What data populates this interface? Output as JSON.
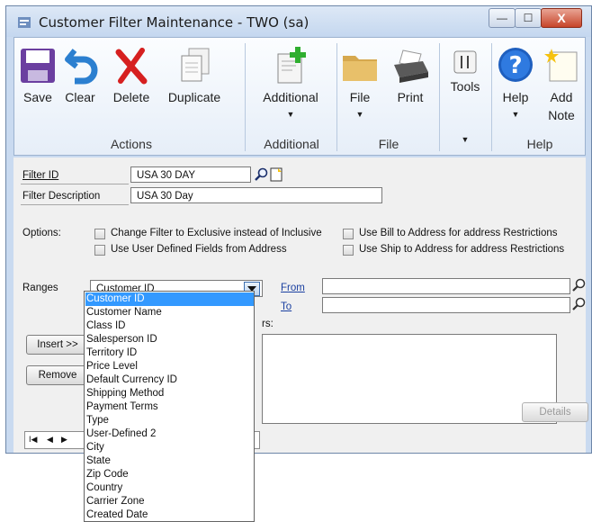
{
  "window": {
    "title": "Customer Filter Maintenance  -  TWO (sa)",
    "caption_min": "—",
    "caption_max": "☐",
    "caption_close": "X"
  },
  "ribbon": {
    "save": "Save",
    "clear": "Clear",
    "delete": "Delete",
    "duplicate": "Duplicate",
    "additional": "Additional",
    "file": "File",
    "print": "Print",
    "tools": "Tools",
    "help": "Help",
    "add_note_1": "Add",
    "add_note_2": "Note",
    "groups": {
      "actions": "Actions",
      "additional": "Additional",
      "file": "File",
      "help": "Help"
    }
  },
  "form": {
    "filter_id_label": "Filter ID",
    "filter_id_value": "USA 30 DAY",
    "filter_desc_label": "Filter Description",
    "filter_desc_value": "USA 30 Day",
    "options_label": "Options:",
    "opt_exclusive": "Change Filter to Exclusive instead of Inclusive",
    "opt_user_defined": "Use User Defined Fields from Address",
    "opt_bill_to": "Use Bill to Address for address Restrictions",
    "opt_ship_to": "Use Ship to Address for address Restrictions",
    "ranges_label": "Ranges",
    "ranges_value": "Customer ID",
    "from_label": "From",
    "to_label": "To",
    "restrictions_label_partial": "rs:",
    "insert_button": "Insert >>",
    "remove_button": "Remove",
    "details_button": "Details"
  },
  "nav": {
    "first": "I◀",
    "prev": "◀",
    "next": "▶"
  },
  "dropdown": {
    "selected_index": 0,
    "items": [
      "Customer ID",
      "Customer Name",
      "Class ID",
      "Salesperson ID",
      "Territory ID",
      "Price Level",
      "Default Currency ID",
      "Shipping Method",
      "Payment Terms",
      "Type",
      "User-Defined 2",
      "City",
      "State",
      "Zip Code",
      "Country",
      "Carrier Zone",
      "Created Date"
    ]
  },
  "colors": {
    "window_frame": "#c9daf0",
    "selection": "#3399ff",
    "close_button": "#c7452a"
  },
  "icons": [
    "save-icon",
    "clear-icon",
    "delete-icon",
    "duplicate-icon",
    "additional-icon",
    "file-icon",
    "print-icon",
    "tools-icon",
    "help-icon",
    "add-note-icon",
    "lookup-icon",
    "note-icon"
  ]
}
